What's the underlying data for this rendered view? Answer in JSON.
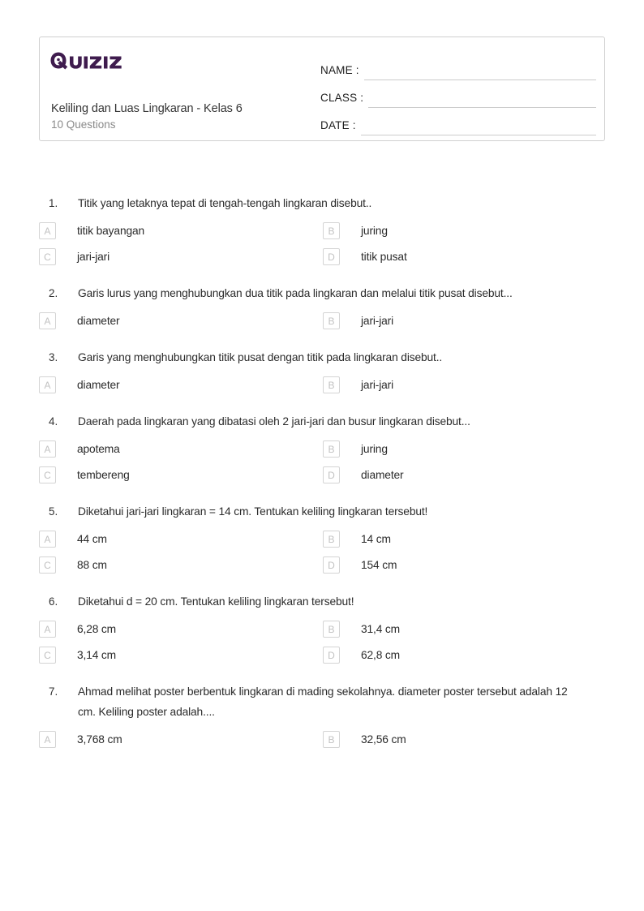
{
  "header": {
    "logo_text": "Quizizz",
    "logo_color": "#3f1c4e",
    "title": "Keliling dan Luas Lingkaran - Kelas 6",
    "subtitle": "10 Questions",
    "fields": [
      {
        "label": "NAME :"
      },
      {
        "label": "CLASS :"
      },
      {
        "label": "DATE  :"
      }
    ]
  },
  "questions": [
    {
      "number": "1.",
      "text": "Titik yang letaknya tepat di tengah-tengah lingkaran disebut..",
      "options": [
        {
          "letter": "A",
          "text": "titik bayangan"
        },
        {
          "letter": "B",
          "text": "juring"
        },
        {
          "letter": "C",
          "text": "jari-jari"
        },
        {
          "letter": "D",
          "text": "titik pusat"
        }
      ]
    },
    {
      "number": "2.",
      "text": "Garis lurus yang menghubungkan dua titik pada lingkaran dan melalui titik pusat disebut...",
      "options": [
        {
          "letter": "A",
          "text": "diameter"
        },
        {
          "letter": "B",
          "text": "jari-jari"
        }
      ]
    },
    {
      "number": "3.",
      "text": "Garis yang menghubungkan titik pusat dengan titik pada lingkaran disebut..",
      "options": [
        {
          "letter": "A",
          "text": "diameter"
        },
        {
          "letter": "B",
          "text": "jari-jari"
        }
      ]
    },
    {
      "number": "4.",
      "text": "Daerah pada lingkaran yang dibatasi oleh 2 jari-jari dan busur lingkaran disebut...",
      "options": [
        {
          "letter": "A",
          "text": "apotema"
        },
        {
          "letter": "B",
          "text": "juring"
        },
        {
          "letter": "C",
          "text": "tembereng"
        },
        {
          "letter": "D",
          "text": "diameter"
        }
      ]
    },
    {
      "number": "5.",
      "text": "Diketahui jari-jari lingkaran = 14 cm. Tentukan keliling lingkaran tersebut!",
      "options": [
        {
          "letter": "A",
          "text": "44 cm"
        },
        {
          "letter": "B",
          "text": "14 cm"
        },
        {
          "letter": "C",
          "text": "88 cm"
        },
        {
          "letter": "D",
          "text": "154 cm"
        }
      ]
    },
    {
      "number": "6.",
      "text": "Diketahui d = 20 cm. Tentukan keliling lingkaran tersebut!",
      "options": [
        {
          "letter": "A",
          "text": "6,28 cm"
        },
        {
          "letter": "B",
          "text": "31,4 cm"
        },
        {
          "letter": "C",
          "text": "3,14 cm"
        },
        {
          "letter": "D",
          "text": "62,8 cm"
        }
      ]
    },
    {
      "number": "7.",
      "text": "Ahmad melihat poster berbentuk lingkaran di mading sekolahnya. diameter poster tersebut adalah 12 cm. Keliling poster adalah....",
      "options": [
        {
          "letter": "A",
          "text": "3,768 cm"
        },
        {
          "letter": "B",
          "text": "32,56 cm"
        }
      ]
    }
  ]
}
